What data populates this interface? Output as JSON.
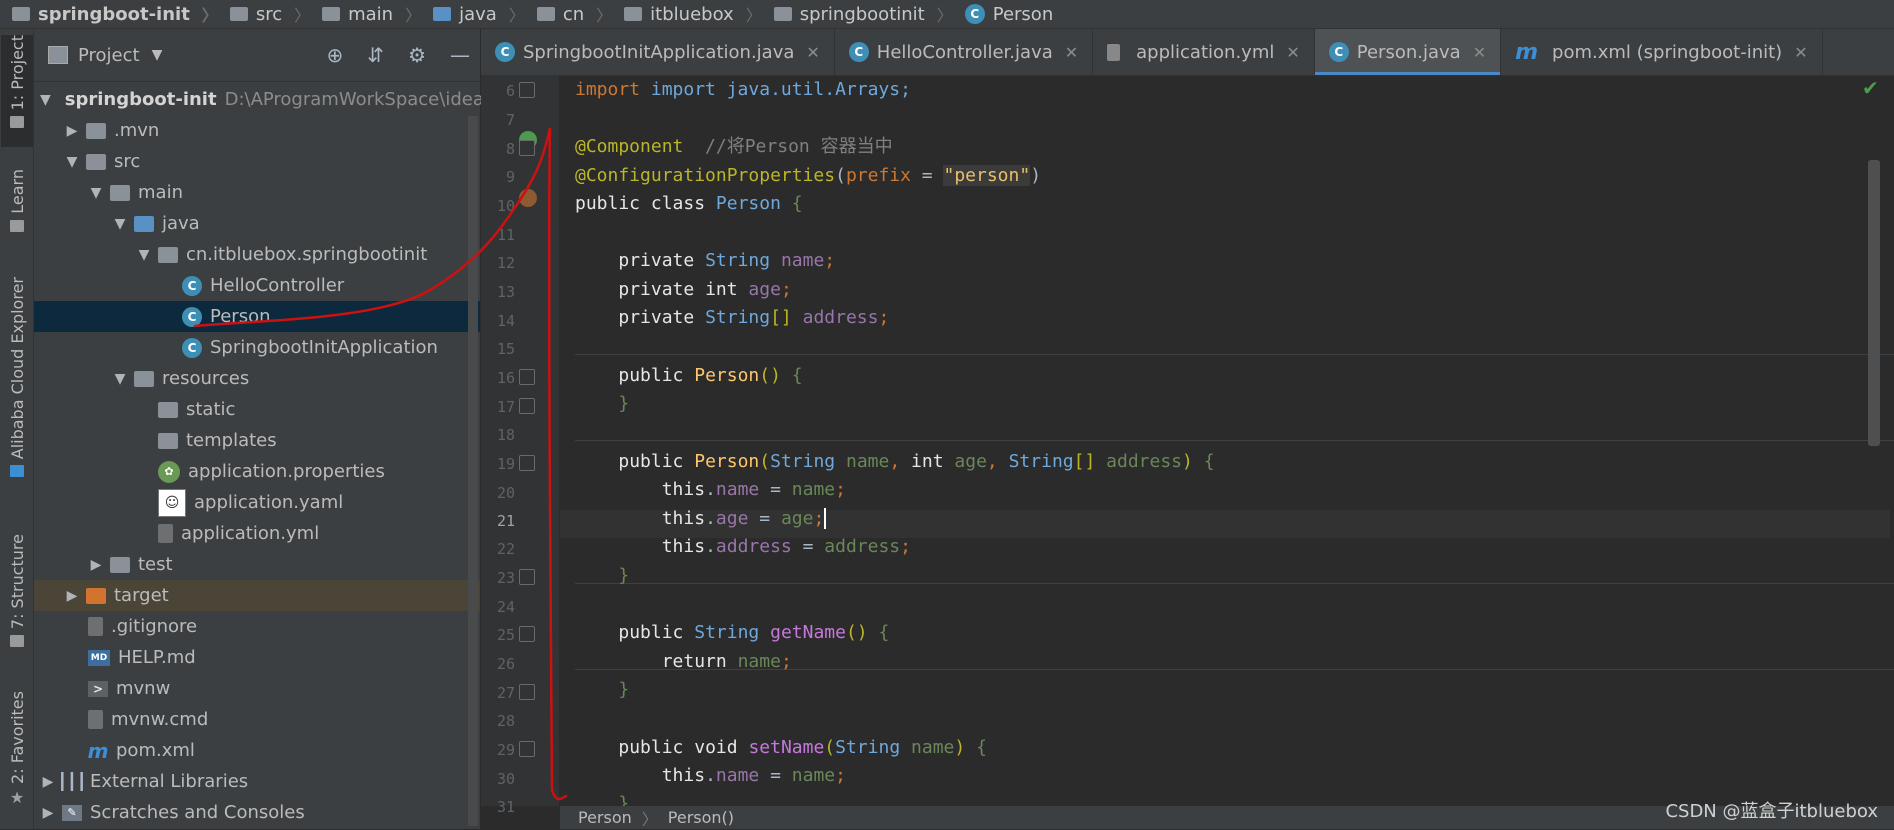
{
  "breadcrumb": {
    "items": [
      "springboot-init",
      "src",
      "main",
      "java",
      "cn",
      "itbluebox",
      "springbootinit",
      "Person"
    ]
  },
  "left_stripe": {
    "tabs": [
      "1: Project",
      "Learn",
      "Alibaba Cloud Explorer",
      "7: Structure",
      "2: Favorites"
    ]
  },
  "project_panel": {
    "title": "Project",
    "root_name": "springboot-init",
    "root_path": "D:\\AProgramWorkSpace\\idea\\s",
    "items": [
      ".mvn",
      "src",
      "main",
      "java",
      "cn.itbluebox.springbootinit",
      "HelloController",
      "Person",
      "SpringbootInitApplication",
      "resources",
      "static",
      "templates",
      "application.properties",
      "application.yaml",
      "application.yml",
      "test",
      "target",
      ".gitignore",
      "HELP.md",
      "mvnw",
      "mvnw.cmd",
      "pom.xml",
      "External Libraries",
      "Scratches and Consoles"
    ]
  },
  "editor_tabs": [
    {
      "label": "SpringbootInitApplication.java"
    },
    {
      "label": "HelloController.java"
    },
    {
      "label": "application.yml"
    },
    {
      "label": "Person.java"
    },
    {
      "label": "pom.xml (springboot-init)"
    }
  ],
  "line_numbers": [
    "6",
    "7",
    "8",
    "9",
    "10",
    "11",
    "12",
    "13",
    "14",
    "15",
    "16",
    "17",
    "18",
    "19",
    "20",
    "21",
    "22",
    "23",
    "24",
    "25",
    "26",
    "27",
    "28",
    "29",
    "30",
    "31"
  ],
  "code": {
    "l6": "import java.util.Arrays;",
    "l8_ann": "@Component",
    "l8_cmt": "  //将Person 容器当中",
    "l9_ann": "@ConfigurationProperties",
    "l9_attr": "prefix",
    "l9_str": "\"person\"",
    "l10_kw": "public class",
    "l10_name": "Person",
    "l12_type": "String",
    "l12_field": "name",
    "l13_type": "int",
    "l13_field": "age",
    "l14_type": "String",
    "l14_field": "address",
    "l16_name": "Person",
    "l19_name": "Person",
    "l25_method": "getName",
    "l26_field": "name",
    "l29_method": "setName"
  },
  "status_bar": {
    "crumb1": "Person",
    "crumb2": "Person()"
  },
  "watermark": "CSDN @蓝盒子itbluebox",
  "colors": {
    "accent": "#4a88c7",
    "selection": "#0d293e",
    "annotation_line": "#cc1111"
  }
}
